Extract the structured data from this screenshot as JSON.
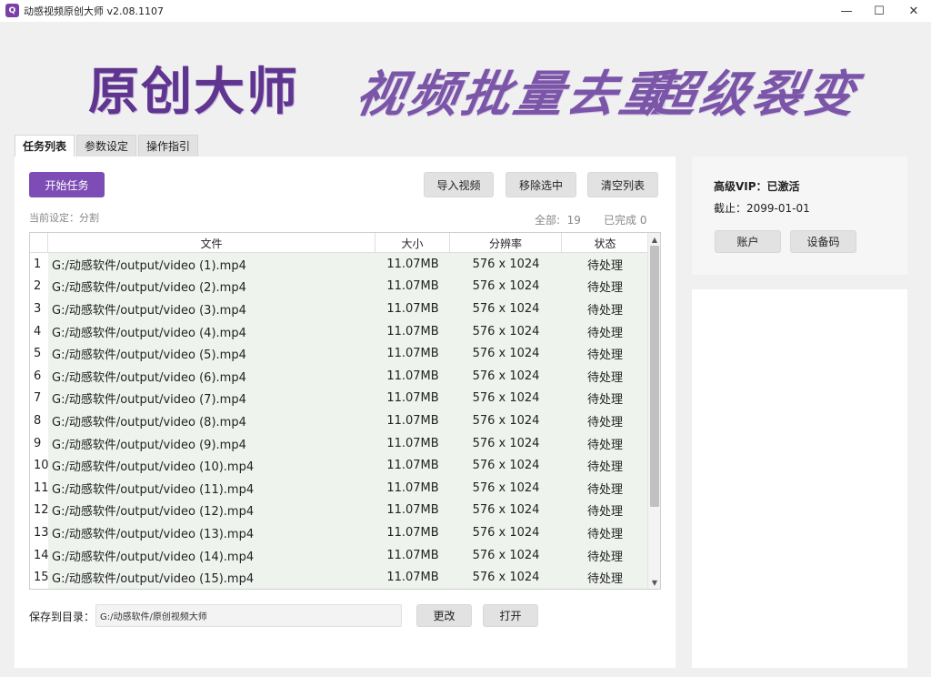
{
  "window": {
    "title": "动感视频原创大师 v2.08.1107",
    "icon_letter": "Q",
    "minimize_glyph": "—",
    "maximize_glyph": "☐",
    "close_glyph": "✕"
  },
  "banner": {
    "main": "原创大师",
    "sub1": "视频批量去重",
    "sub2": "超级裂变"
  },
  "tabs": [
    {
      "label": "任务列表",
      "active": true
    },
    {
      "label": "参数设定",
      "active": false
    },
    {
      "label": "操作指引",
      "active": false
    }
  ],
  "toolbar": {
    "start_label": "开始任务",
    "import_label": "导入视频",
    "remove_label": "移除选中",
    "clear_label": "清空列表"
  },
  "status": {
    "current_setting": "当前设定：分割",
    "total": "全部:  19",
    "completed": "已完成 0"
  },
  "table": {
    "headers": [
      "文件",
      "大小",
      "分辨率",
      "状态"
    ],
    "rows": [
      {
        "idx": "1",
        "file": "G:/动感软件/output/video (1).mp4",
        "size": "11.07MB",
        "res": "576 x  1024",
        "status": "待处理"
      },
      {
        "idx": "2",
        "file": "G:/动感软件/output/video (2).mp4",
        "size": "11.07MB",
        "res": "576 x  1024",
        "status": "待处理"
      },
      {
        "idx": "3",
        "file": "G:/动感软件/output/video (3).mp4",
        "size": "11.07MB",
        "res": "576 x  1024",
        "status": "待处理"
      },
      {
        "idx": "4",
        "file": "G:/动感软件/output/video (4).mp4",
        "size": "11.07MB",
        "res": "576 x  1024",
        "status": "待处理"
      },
      {
        "idx": "5",
        "file": "G:/动感软件/output/video (5).mp4",
        "size": "11.07MB",
        "res": "576 x  1024",
        "status": "待处理"
      },
      {
        "idx": "6",
        "file": "G:/动感软件/output/video (6).mp4",
        "size": "11.07MB",
        "res": "576 x  1024",
        "status": "待处理"
      },
      {
        "idx": "7",
        "file": "G:/动感软件/output/video (7).mp4",
        "size": "11.07MB",
        "res": "576 x  1024",
        "status": "待处理"
      },
      {
        "idx": "8",
        "file": "G:/动感软件/output/video (8).mp4",
        "size": "11.07MB",
        "res": "576 x  1024",
        "status": "待处理"
      },
      {
        "idx": "9",
        "file": "G:/动感软件/output/video (9).mp4",
        "size": "11.07MB",
        "res": "576 x  1024",
        "status": "待处理"
      },
      {
        "idx": "10",
        "file": "G:/动感软件/output/video (10).mp4",
        "size": "11.07MB",
        "res": "576 x  1024",
        "status": "待处理"
      },
      {
        "idx": "11",
        "file": "G:/动感软件/output/video (11).mp4",
        "size": "11.07MB",
        "res": "576 x  1024",
        "status": "待处理"
      },
      {
        "idx": "12",
        "file": "G:/动感软件/output/video (12).mp4",
        "size": "11.07MB",
        "res": "576 x  1024",
        "status": "待处理"
      },
      {
        "idx": "13",
        "file": "G:/动感软件/output/video (13).mp4",
        "size": "11.07MB",
        "res": "576 x  1024",
        "status": "待处理"
      },
      {
        "idx": "14",
        "file": "G:/动感软件/output/video (14).mp4",
        "size": "11.07MB",
        "res": "576 x  1024",
        "status": "待处理"
      },
      {
        "idx": "15",
        "file": "G:/动感软件/output/video (15).mp4",
        "size": "11.07MB",
        "res": "576 x  1024",
        "status": "待处理"
      }
    ],
    "scroll_up_glyph": "▲",
    "scroll_down_glyph": "▼"
  },
  "save": {
    "label": "保存到目录：",
    "path": "G:/动感软件/原创视频大师",
    "change_label": "更改",
    "open_label": "打开"
  },
  "vip": {
    "status": "高级VIP：已激活",
    "expire": "截止：2099-01-01",
    "account_label": "账户",
    "device_label": "设备码"
  },
  "colors": {
    "accent": "#7d4db5",
    "banner": "#5f3590",
    "row_bg": "#eef3ee"
  }
}
